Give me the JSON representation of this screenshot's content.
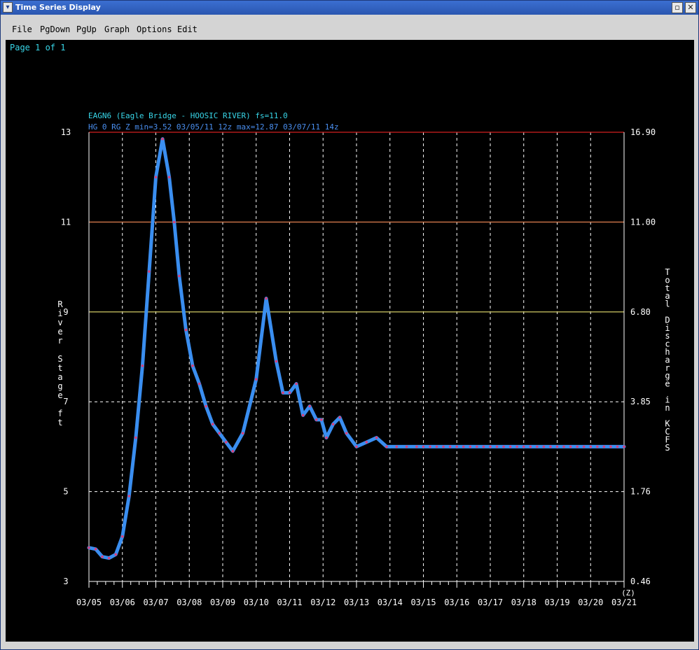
{
  "window": {
    "title": "Time Series Display",
    "system_menu_icon": "chevron-down-icon",
    "maximize_icon": "maximize-icon",
    "close_icon": "close-icon"
  },
  "menu": [
    "File",
    "PgDown",
    "PgUp",
    "Graph",
    "Options",
    "Edit"
  ],
  "page_label": "Page 1 of 1",
  "colors": {
    "background": "#000000",
    "series": "#3a8ef0",
    "observed_points": "#d8407a",
    "text_cyan": "#38d6e8",
    "text_blue": "#4a8ff0",
    "threshold_red": "#d42020",
    "threshold_orange": "#e08050",
    "threshold_yellow": "#e8e070"
  },
  "chart_data": {
    "type": "line",
    "title": "EAGN6 (Eagle Bridge - HOOSIC RIVER) fs=11.0",
    "subtitle": "HG 0 RG Z min=3.52 03/05/11 12z max=12.87 03/07/11 14z",
    "ylabel": "River Stage ft",
    "y2label": "Total Discharge in KCFS",
    "xunit_label": "(Z)",
    "ylim": [
      3,
      13
    ],
    "yticks": [
      "13",
      "11",
      "9",
      "7",
      "5",
      "3"
    ],
    "y2ticks": [
      "16.90",
      "11.00",
      "6.80",
      "3.85",
      "1.76",
      "0.46"
    ],
    "categories": [
      "03/05",
      "03/06",
      "03/07",
      "03/08",
      "03/09",
      "03/10",
      "03/11",
      "03/12",
      "03/13",
      "03/14",
      "03/15",
      "03/16",
      "03/17",
      "03/18",
      "03/19",
      "03/20",
      "03/21"
    ],
    "threshold_lines": [
      {
        "y": 13,
        "color": "red"
      },
      {
        "y": 11,
        "color": "orange"
      },
      {
        "y": 9,
        "color": "yellow"
      }
    ],
    "grid": true,
    "series": [
      {
        "x": [
          0,
          0.2,
          0.4,
          0.6,
          0.8,
          1.0,
          1.2,
          1.4,
          1.6,
          1.8,
          2.0,
          2.2,
          2.4,
          2.55,
          2.7,
          2.9,
          3.1,
          3.3,
          3.5,
          3.7,
          3.9,
          4.1,
          4.3,
          4.6,
          5.0,
          5.3,
          5.6,
          5.8,
          6.0,
          6.2,
          6.4,
          6.6,
          6.8,
          6.95,
          7.1,
          7.3,
          7.5,
          7.7,
          8.0,
          8.3,
          8.6,
          8.9,
          9.2,
          9.5,
          9.8,
          10.0,
          10.2,
          10.4,
          10.6,
          10.8,
          11.0,
          11.2,
          11.4,
          11.6,
          11.8,
          12.0,
          12.2,
          12.4,
          12.6,
          12.8,
          13.0,
          13.2,
          13.4,
          13.6,
          13.8,
          14.0,
          14.2,
          14.4,
          14.6,
          14.8,
          15.0,
          15.2,
          15.4,
          15.6,
          15.8,
          16.0
        ],
        "y": [
          3.75,
          3.72,
          3.55,
          3.52,
          3.6,
          4.0,
          4.9,
          6.2,
          7.8,
          9.9,
          12.0,
          12.85,
          12.0,
          11.0,
          9.8,
          8.6,
          7.8,
          7.4,
          6.9,
          6.5,
          6.3,
          6.1,
          5.9,
          6.3,
          7.5,
          9.3,
          7.9,
          7.2,
          7.2,
          7.4,
          6.7,
          6.9,
          6.6,
          6.6,
          6.2,
          6.5,
          6.65,
          6.3,
          6.0,
          6.1,
          6.2,
          6.0,
          6.0,
          6.0,
          6.0,
          6.0,
          6.0,
          6.0,
          6.0,
          6.0,
          6.0,
          6.0,
          6.0,
          6.0,
          6.0,
          6.0,
          6.0,
          6.0,
          6.0,
          6.0,
          6.0,
          6.0,
          6.0,
          6.0,
          6.0,
          6.0,
          6.0,
          6.0,
          6.0,
          6.0,
          6.0,
          6.0,
          6.0,
          6.0,
          6.0,
          6.0
        ]
      }
    ]
  }
}
